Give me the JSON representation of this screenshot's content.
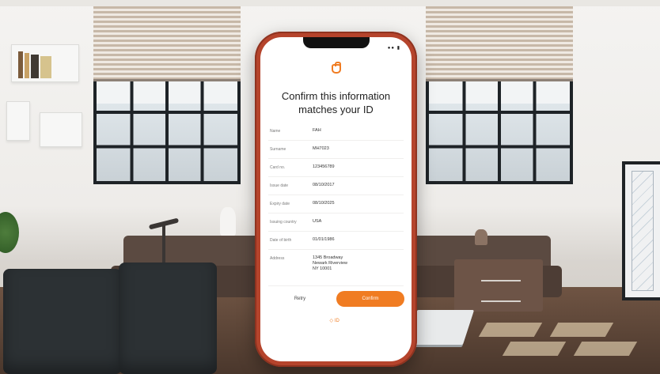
{
  "screen": {
    "status_icons": "●● ▮",
    "title": "Confirm this information matches your ID",
    "fields": [
      {
        "label": "Name",
        "value": "FAH"
      },
      {
        "label": "Surname",
        "value": "MH7023"
      },
      {
        "label": "Card no.",
        "value": "123456789"
      },
      {
        "label": "Issue date",
        "value": "08/10/2017"
      },
      {
        "label": "Expiry date",
        "value": "08/10/2025"
      },
      {
        "label": "Issuing country",
        "value": "USA"
      },
      {
        "label": "Date of birth",
        "value": "01/01/1986"
      },
      {
        "label": "Address",
        "value": "1345 Broadway\nNewark Riverview\nNY 10001"
      }
    ],
    "retry_label": "Retry",
    "confirm_label": "Confirm",
    "footer_label": "◇ ID"
  },
  "colors": {
    "accent": "#f07c22",
    "phone_case": "#b5442c"
  }
}
